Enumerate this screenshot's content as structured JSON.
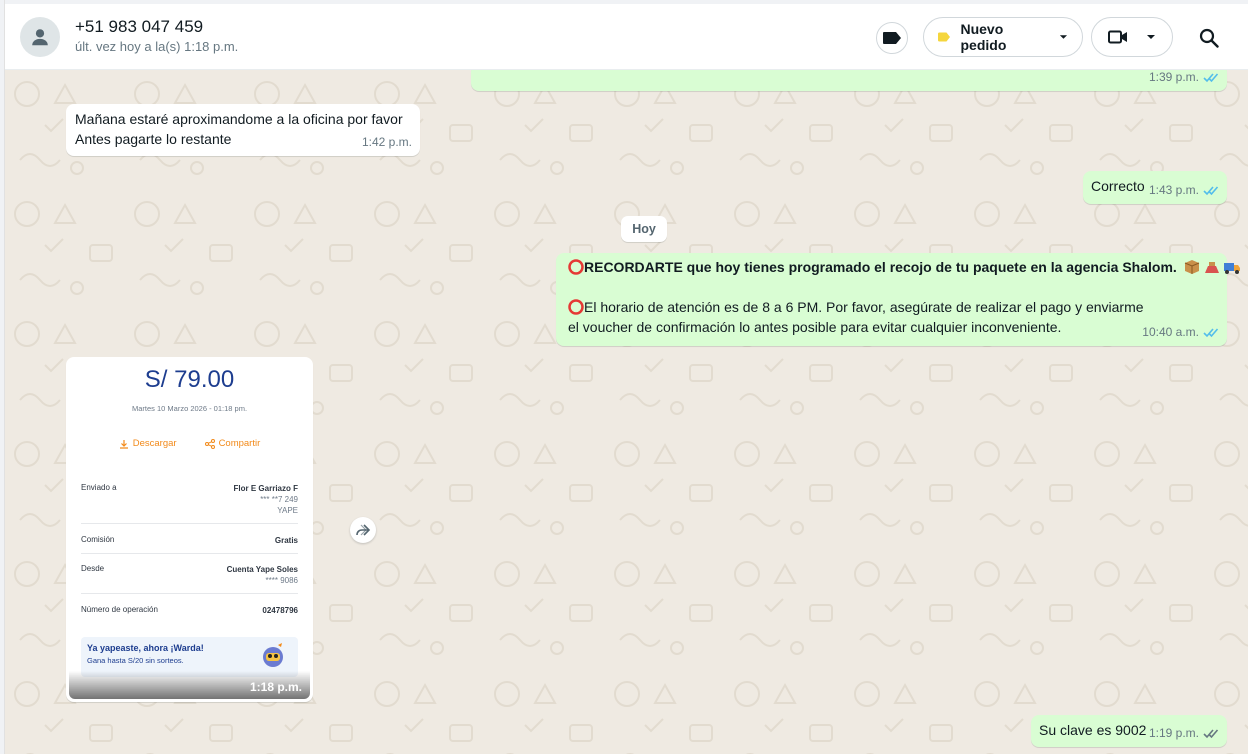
{
  "header": {
    "contact_name": "+51 983 047 459",
    "contact_status": "últ. vez hoy a la(s) 1:18 p.m.",
    "order_button_label": "Nuevo pedido",
    "label_tag_color": "#f5d63d",
    "icons": [
      "default-avatar-icon",
      "label-tag-icon",
      "video-call-icon",
      "chevron-down-icon",
      "search-icon"
    ]
  },
  "chat": {
    "background_color": "#efeae2",
    "day_divider": "Hoy",
    "messages": [
      {
        "dir": "out",
        "text": "",
        "time": "1:39 p.m.",
        "status": "read"
      },
      {
        "dir": "in",
        "lines": [
          "Mañana estaré aproximandome a la oficina por favor",
          "Antes pagarte lo restante"
        ],
        "time": "1:42 p.m."
      },
      {
        "dir": "out",
        "text": "Correcto",
        "time": "1:43 p.m.",
        "status": "read"
      },
      {
        "dir": "out",
        "bold_line": "RECORDARTE que hoy tienes programado el recojo de tu paquete en la agencia Shalom.",
        "line2": "El horario de atención es de 8 a 6 PM. Por favor, asegúrate de realizar el pago y enviarme",
        "line3": "el voucher de confirmación lo antes posible para evitar cualquier inconveniente.",
        "time": "10:40 a.m.",
        "status": "read"
      },
      {
        "dir": "out",
        "text": "Su clave es 9002",
        "time": "1:19 p.m.",
        "status": "delivered"
      }
    ]
  },
  "receipt": {
    "amount": "S/ 79.00",
    "date": "Martes 10 Marzo 2026 - 01:18 pm.",
    "download_label": "Descargar",
    "share_label": "Compartir",
    "rows": [
      {
        "key": "Enviado a",
        "value": "Flor E Garriazo F",
        "sub1": "*** **7 249",
        "sub2": "YAPE"
      },
      {
        "key": "Comisión",
        "value": "Gratis"
      },
      {
        "key": "Desde",
        "value": "Cuenta Yape Soles",
        "sub1": "**** 9086"
      },
      {
        "key": "Número de operación",
        "value": "02478796"
      }
    ],
    "promo_title": "Ya yapeaste, ahora ¡Warda!",
    "promo_sub": "Gana hasta S/20 sin sorteos.",
    "time": "1:18 p.m."
  },
  "colors": {
    "outgoing_bubble": "#d9fdd3",
    "incoming_bubble": "#ffffff",
    "read_ticks": "#53bdeb",
    "yape_blue": "#1d3d8f",
    "yape_orange": "#f28a1a"
  }
}
